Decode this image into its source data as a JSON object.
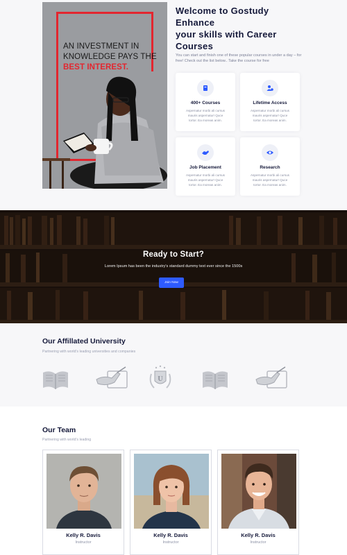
{
  "hero": {
    "quote_line1": "AN INVESTMENT IN",
    "quote_line2": "KNOWLEDGE PAYS THE",
    "quote_highlight": "BEST INTEREST.",
    "title_line1": "Welcome to Gostudy",
    "title_line2": "Enhance",
    "title_line3": "your skills with Career",
    "title_line4": "Courses",
    "subtitle": "You can start and finish one of these popular courses in under a day – for free! Check out the list below.. Take the course for free",
    "features": [
      {
        "title": "400+ Courses",
        "icon": "book-icon",
        "desc": "Aspernatur morbi ali cursus mauris aspernatur! Quce tortor. Ea moreas anim."
      },
      {
        "title": "Lifetime Access",
        "icon": "users-icon",
        "desc": "Aspernatur morbi ali cursus mauris aspernatur! Quce tortor. Ea moreas anim."
      },
      {
        "title": "Job Placement",
        "icon": "handshake-icon",
        "desc": "Aspernatur morbi ali cursus mauris aspernatur! Quce tortor. Ea moreas anim."
      },
      {
        "title": "Research",
        "icon": "eye-icon",
        "desc": "Aspernatur morbi ali cursus mauris aspernatur! Quce tortor. Ea moreas anim."
      }
    ],
    "accent_color": "#e3262f",
    "icon_color": "#2e5bff"
  },
  "cta": {
    "title": "Ready to Start?",
    "text": "Lorem Ipsum has been the industry's standard dummy text ever since the 1500s",
    "button": "Join Now",
    "button_color": "#2e5bff"
  },
  "affiliated": {
    "title": "Our Affillated University",
    "subtitle": "Partnering with world's leading universities and companies",
    "logos": [
      "open-book-logo",
      "hand-writing-logo",
      "university-crest-logo",
      "open-book-logo",
      "hand-writing-logo"
    ]
  },
  "team": {
    "title": "Our Team",
    "subtitle": "Partnering with world's leading",
    "members": [
      {
        "name": "Kelly R. Davis",
        "role": "Instructor"
      },
      {
        "name": "Kelly R. Davis",
        "role": "Instructor"
      },
      {
        "name": "Kelly R. Davis",
        "role": "Instructor"
      }
    ]
  }
}
